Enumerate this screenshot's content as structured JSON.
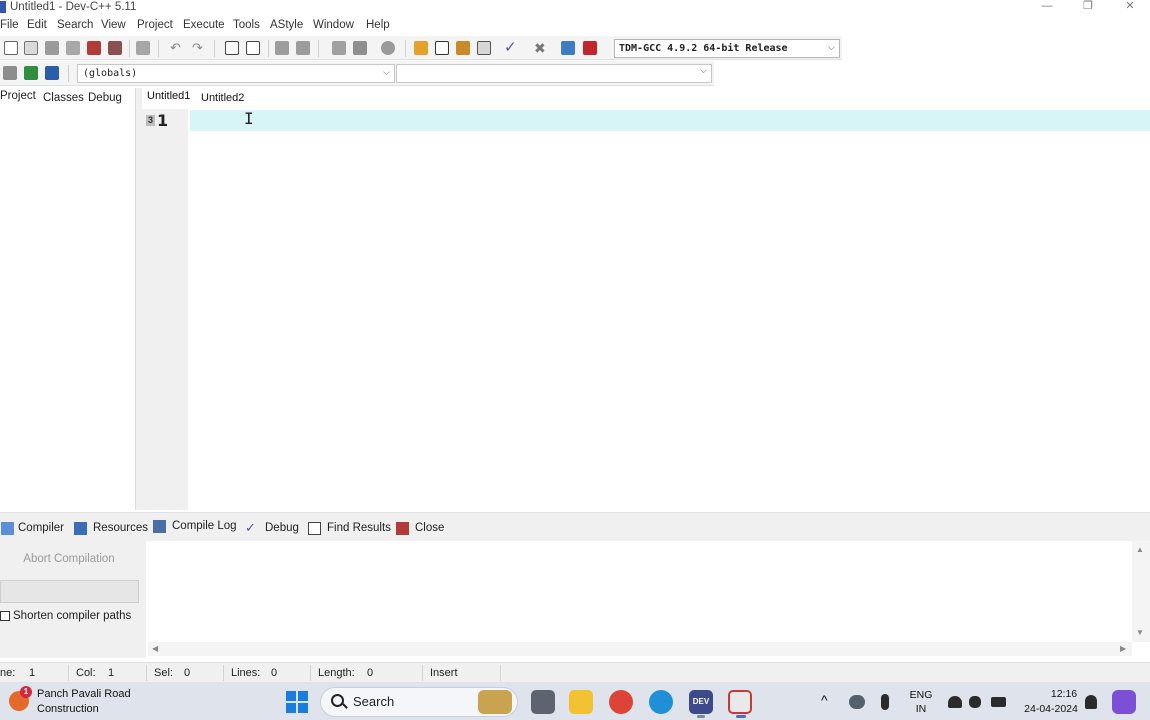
{
  "window": {
    "title": "Untitled1 - Dev-C++ 5.11",
    "minimize_glyph": "—",
    "restore_glyph": "❐",
    "close_glyph": "✕"
  },
  "menu": [
    "File",
    "Edit",
    "Search",
    "View",
    "Project",
    "Execute",
    "Tools",
    "AStyle",
    "Window",
    "Help"
  ],
  "toolbar": {
    "compiler_select": "TDM-GCC 4.9.2 64-bit Release",
    "globals_select": "(globals)",
    "function_select": ""
  },
  "left_panel": {
    "tabs": [
      "Project",
      "Classes",
      "Debug"
    ]
  },
  "editor": {
    "tabs": [
      "Untitled1",
      "Untitled2"
    ],
    "active_tab": "Untitled1",
    "fold_marker": "3",
    "line_number": "1",
    "cursor_glyph": "I",
    "content": ""
  },
  "bottom_panel": {
    "tabs": [
      "Compiler",
      "Resources",
      "Compile Log",
      "Debug",
      "Find Results",
      "Close"
    ],
    "active_tab": "Compile Log",
    "abort_button": "Abort Compilation",
    "shorten_paths_label": "Shorten compiler paths",
    "shorten_paths_checked": false
  },
  "status": {
    "line_label": "ne:",
    "line_value": "1",
    "col_label": "Col:",
    "col_value": "1",
    "sel_label": "Sel:",
    "sel_value": "0",
    "lines_label": "Lines:",
    "lines_value": "0",
    "length_label": "Length:",
    "length_value": "0",
    "mode": "Insert"
  },
  "taskbar": {
    "weather_badge": "1",
    "weather_title": "Panch Pavali Road",
    "weather_sub": "Construction",
    "search_label": "Search",
    "dev_tile_text": "DEV",
    "tray_up_glyph": "^",
    "lang_top": "ENG",
    "lang_bottom": "IN",
    "time": "12:16",
    "date": "24-04-2024"
  },
  "colors": {
    "current_line": "#d7f4f7",
    "gutter": "#f0f0f0",
    "panel_bg": "#f0f0f0",
    "taskbar": "#dfe4ec",
    "accent_blue": "#1a7de0"
  }
}
